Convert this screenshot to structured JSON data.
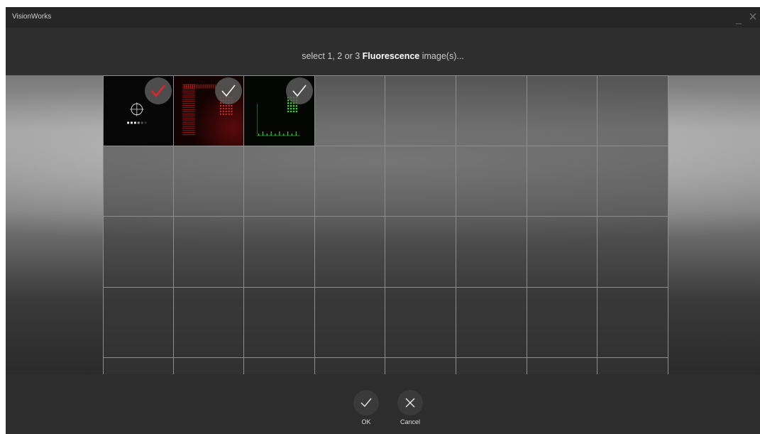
{
  "window": {
    "title": "VisionWorks",
    "minimize_icon": "minimize-icon",
    "close_icon": "close-icon"
  },
  "prompt": {
    "prefix": "select 1, 2 or 3 ",
    "emphasis": "Fluorescence",
    "suffix": " image(s)..."
  },
  "gallery": {
    "columns": 8,
    "visible_rows": 5,
    "thumbnails": [
      {
        "slot": 0,
        "selected": true,
        "check_color": "#e0242c",
        "content": "target-and-dots"
      },
      {
        "slot": 1,
        "selected": true,
        "check_color": "#ffffff",
        "content": "red-fluorescence"
      },
      {
        "slot": 2,
        "selected": true,
        "check_color": "#ffffff",
        "content": "green-fluorescence"
      }
    ]
  },
  "actions": {
    "ok_label": "OK",
    "cancel_label": "Cancel"
  },
  "colors": {
    "accent_red": "#e0242c",
    "background": "#2b2b2b"
  }
}
